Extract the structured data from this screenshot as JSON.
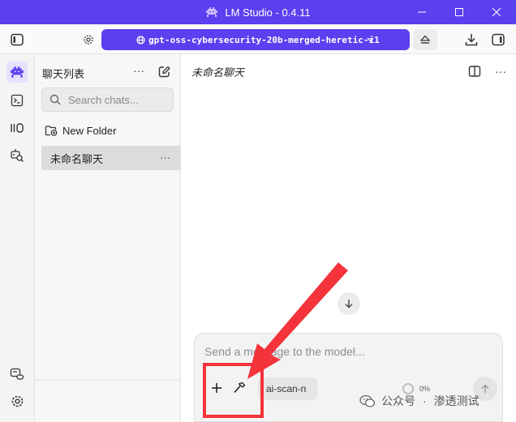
{
  "window": {
    "title": "LM Studio - 0.4.11"
  },
  "toolbar": {
    "model_label": "gpt-oss-cybersecurity-20b-merged-heretic-i1",
    "accent": "#5a40ef"
  },
  "sidebar": {
    "title": "聊天列表",
    "more_label": "···",
    "search_placeholder": "Search chats...",
    "new_folder_label": "New Folder",
    "chats": [
      {
        "label": "未命名聊天",
        "more_label": "···",
        "selected": true
      }
    ]
  },
  "main": {
    "chat_title": "未命名聊天",
    "more_label": "···",
    "composer": {
      "placeholder": "Send a message to the model...",
      "chip_label": "ai-scan-n",
      "context_percent": "0%"
    }
  },
  "annotation": {
    "color": "#f4333b"
  },
  "watermark": {
    "source": "公众号",
    "separator": "·",
    "name": "渗透测试"
  }
}
